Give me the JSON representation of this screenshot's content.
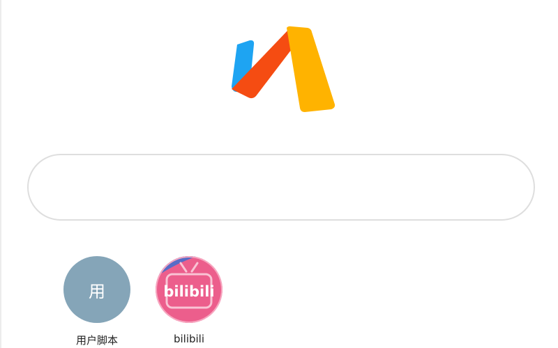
{
  "search": {
    "value": "",
    "placeholder": ""
  },
  "shortcuts": [
    {
      "label": "用户脚本",
      "icon_text": "用",
      "color": "#85a5b8"
    },
    {
      "label": "bilibili",
      "icon_text": "bilibili",
      "color": "#ec5e8c"
    }
  ],
  "logo": {
    "colors": {
      "blue": "#1ea4f2",
      "red": "#f54c12",
      "yellow": "#ffb300"
    }
  }
}
